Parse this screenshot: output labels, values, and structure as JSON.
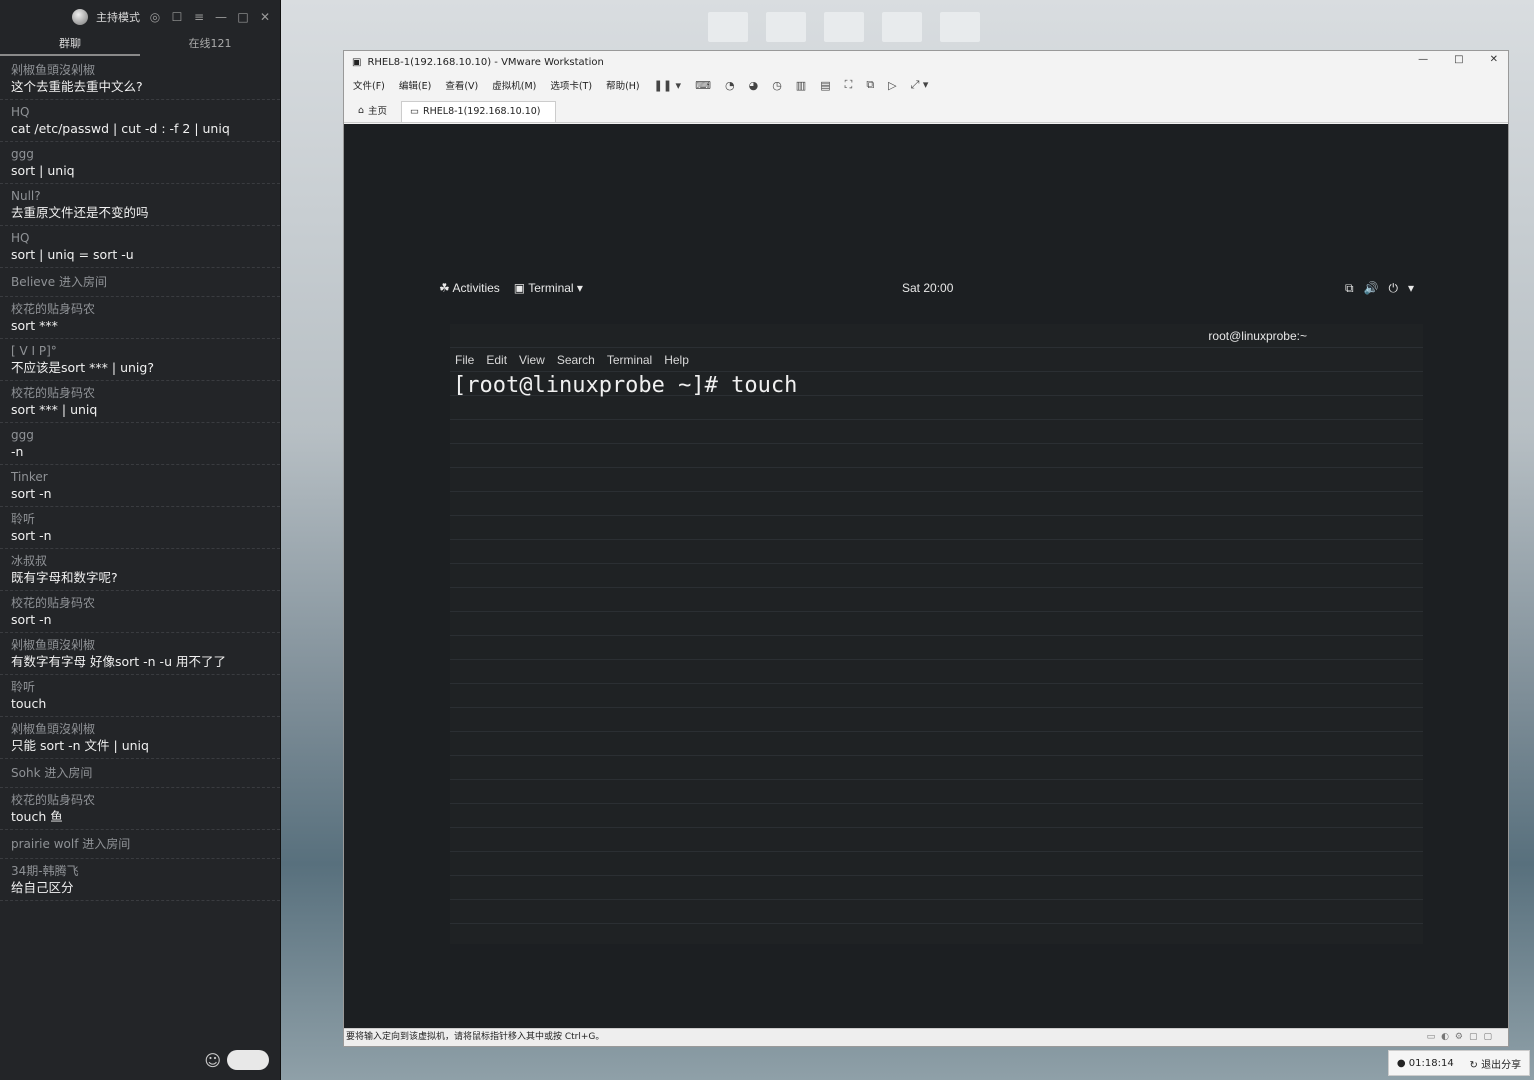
{
  "chat": {
    "header": {
      "mode_label": "主持模式"
    },
    "tabs": [
      "群聊",
      "在线121"
    ],
    "messages": [
      {
        "name": "剁椒鱼頭沒剁椒",
        "text": "这个去重能去重中文么?"
      },
      {
        "name": "HQ",
        "text": "cat /etc/passwd | cut -d : -f 2 | uniq"
      },
      {
        "name": "ggg",
        "text": "sort | uniq"
      },
      {
        "name": "Null?",
        "text": "去重原文件还是不变的吗"
      },
      {
        "name": "HQ",
        "text": "sort | uniq = sort -u"
      },
      {
        "system": "Believe 进入房间"
      },
      {
        "name": "校花的贴身码农",
        "text": "sort ***"
      },
      {
        "name": "[    V      I      P]°",
        "text": "不应该是sort *** | unig?"
      },
      {
        "name": "校花的贴身码农",
        "text": "sort *** | uniq"
      },
      {
        "name": "ggg",
        "text": "-n"
      },
      {
        "name": "Tinker",
        "text": "sort -n"
      },
      {
        "name": "聆听",
        "text": "sort -n"
      },
      {
        "name": "冰叔叔",
        "text": "既有字母和数字呢?"
      },
      {
        "name": "校花的贴身码农",
        "text": "sort -n"
      },
      {
        "name": "剁椒鱼頭沒剁椒",
        "text": "有数字有字母  好像sort -n -u  用不了了"
      },
      {
        "name": "聆听",
        "text": "touch"
      },
      {
        "name": "剁椒鱼頭沒剁椒",
        "text": "只能  sort -n 文件 | uniq"
      },
      {
        "system": "Sohk 进入房间"
      },
      {
        "name": "校花的贴身码农",
        "text": "touch 鱼"
      },
      {
        "system": "prairie wolf 进入房间"
      },
      {
        "name": "34期-韩腾飞",
        "text": "给自己区分"
      }
    ]
  },
  "vmware": {
    "title": "RHEL8-1(192.168.10.10) - VMware Workstation",
    "menu": [
      "文件(F)",
      "编辑(E)",
      "查看(V)",
      "虚拟机(M)",
      "选项卡(T)",
      "帮助(H)"
    ],
    "tabs": [
      "主页",
      "RHEL8-1(192.168.10.10)"
    ],
    "status_text": "要将输入定向到该虚拟机，请将鼠标指针移入其中或按 Ctrl+G。"
  },
  "gnome": {
    "activities": "Activities",
    "app_menu": "Terminal ▾",
    "clock": "Sat 20:00"
  },
  "terminal": {
    "title": "root@linuxprobe:~",
    "menu": [
      "File",
      "Edit",
      "View",
      "Search",
      "Terminal",
      "Help"
    ],
    "line": "[root@linuxprobe ~]# touch"
  },
  "share": {
    "timer": "01:18:14",
    "stop_label": "退出分享"
  }
}
